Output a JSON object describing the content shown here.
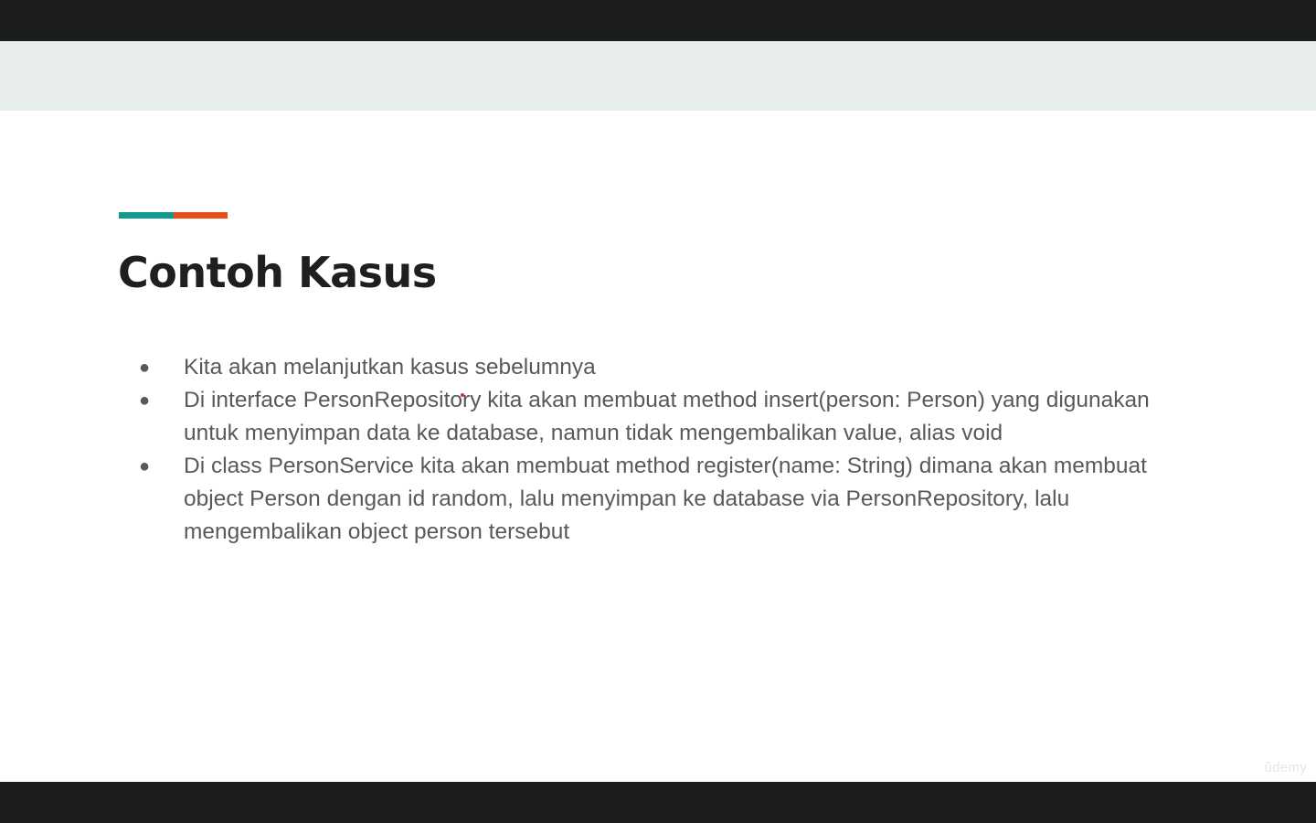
{
  "colors": {
    "accent_teal": "#12998e",
    "accent_orange": "#ea4f18",
    "letterbox": "#1c1d1f",
    "header_band": "#e8eded",
    "pointer": "#e0245e"
  },
  "slide": {
    "title": "Contoh Kasus",
    "bullet_symbol": "●",
    "bullets": [
      {
        "text": "Kita akan melanjutkan kasus sebelumnya"
      },
      {
        "text": "Di interface PersonRepository kita akan membuat method insert(person: Person) yang digunakan untuk menyimpan data ke database, namun tidak mengembalikan value, alias void"
      },
      {
        "text": "Di class PersonService kita akan membuat method register(name: String) dimana akan membuat object Person dengan id random, lalu menyimpan ke database via PersonRepository, lalu mengembalikan object person tersebut"
      }
    ]
  },
  "watermark": "ûdemy"
}
